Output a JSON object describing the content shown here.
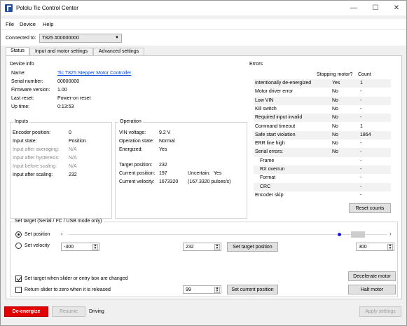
{
  "window": {
    "title": "Pololu Tic Control Center",
    "controls": {
      "minimize": "—",
      "maximize": "☐",
      "close": "✕"
    }
  },
  "menu": {
    "items": [
      "File",
      "Device",
      "Help"
    ]
  },
  "connection": {
    "label": "Connected to:",
    "device": "T825 #00000000"
  },
  "tabs": [
    "Status",
    "Input and motor settings",
    "Advanced settings"
  ],
  "device_info": {
    "title": "Device info",
    "rows": [
      {
        "label": "Name:",
        "value": "Tic T825 Stepper Motor Controller"
      },
      {
        "label": "Serial number:",
        "value": "00000000"
      },
      {
        "label": "Firmware version:",
        "value": "1.00"
      },
      {
        "label": "Last reset:",
        "value": "Power-on reset"
      },
      {
        "label": "Up time:",
        "value": "0:13:53"
      }
    ]
  },
  "inputs": {
    "title": "Inputs",
    "rows": [
      {
        "label": "Encoder position:",
        "value": "0"
      },
      {
        "label": "Input state:",
        "value": "Position"
      },
      {
        "label": "Input after averaging:",
        "value": "N/A"
      },
      {
        "label": "Input after hysteresis:",
        "value": "N/A"
      },
      {
        "label": "Input before scaling:",
        "value": "N/A"
      },
      {
        "label": "Input after scaling:",
        "value": "232"
      }
    ]
  },
  "operation": {
    "title": "Operation",
    "vin_label": "VIN voltage:",
    "vin": "9.2 V",
    "state_label": "Operation state:",
    "state": "Normal",
    "energized_label": "Energized:",
    "energized": "Yes",
    "target_label": "Target position:",
    "target": "232",
    "current_label": "Current position:",
    "current": "197",
    "uncertain_label": "Uncertain:",
    "uncertain": "Yes",
    "velocity_label": "Current velocity:",
    "velocity": "1673320",
    "velocity_pps": "(167.3320 pulses/s)"
  },
  "errors": {
    "title": "Errors",
    "col_stopping": "Stopping motor?",
    "col_count": "Count",
    "rows": [
      {
        "name": "Intentionally de-energized",
        "stopping": "Yes",
        "count": "1"
      },
      {
        "name": "Motor driver error",
        "stopping": "No",
        "count": "-"
      },
      {
        "name": "Low VIN",
        "stopping": "No",
        "count": "-"
      },
      {
        "name": "Kill switch",
        "stopping": "No",
        "count": "-"
      },
      {
        "name": "Required input invalid",
        "stopping": "No",
        "count": "-"
      },
      {
        "name": "Command timeout",
        "stopping": "No",
        "count": "1"
      },
      {
        "name": "Safe start violation",
        "stopping": "No",
        "count": "1864"
      },
      {
        "name": "ERR line high",
        "stopping": "No",
        "count": "-"
      },
      {
        "name": "Serial errors:",
        "stopping": "No",
        "count": "-"
      },
      {
        "name": "Frame",
        "stopping": "",
        "count": "-"
      },
      {
        "name": "RX overrun",
        "stopping": "",
        "count": "-"
      },
      {
        "name": "Format",
        "stopping": "",
        "count": "-"
      },
      {
        "name": "CRC",
        "stopping": "",
        "count": "-"
      },
      {
        "name": "Encoder skip",
        "stopping": "",
        "count": "-"
      }
    ],
    "reset_button": "Reset counts"
  },
  "set_target": {
    "title": "Set target (Serial / I²C / USB mode only)",
    "position_radio": "Set position",
    "velocity_radio": "Set velocity",
    "min_value": "-300",
    "entry_value": "232",
    "max_value": "300",
    "set_target_button": "Set target position",
    "slider_fraction": 0.886,
    "checkbox_target_label": "Set target when slider or entry box are changed",
    "checkbox_return_label": "Return slider to zero when it is released",
    "current_value": "99",
    "set_current_button": "Set current position",
    "decelerate_button": "Decelerate motor",
    "halt_button": "Halt motor"
  },
  "statusbar": {
    "deenergize": "De-energize",
    "resume": "Resume",
    "state_text": "Driving",
    "apply": "Apply settings"
  },
  "colors": {
    "deenergize_bg": "#e20000",
    "link": "#0645d6",
    "slider_dot": "#1a1adb"
  }
}
